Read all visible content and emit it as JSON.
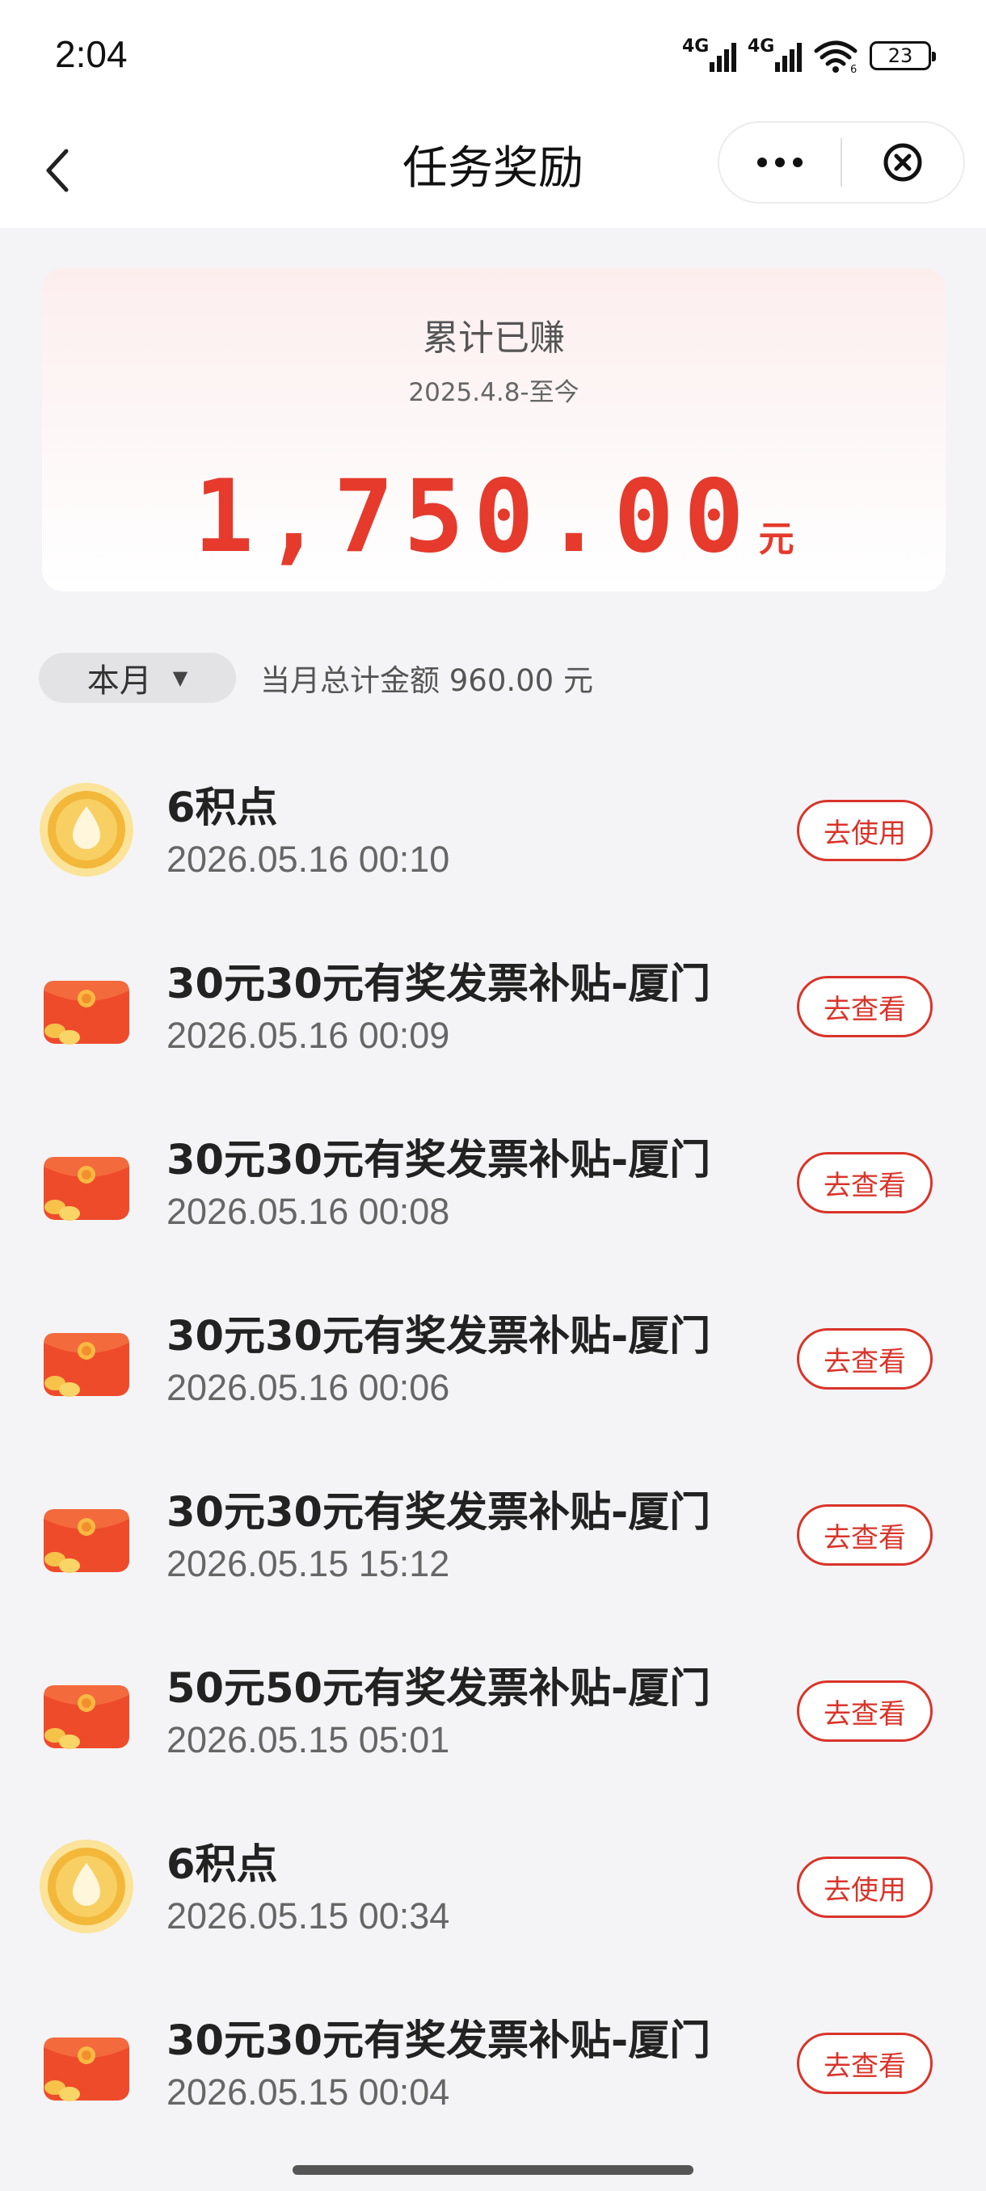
{
  "status_bar": {
    "time": "2:04",
    "signal1_label": "4G",
    "signal2_label": "4G",
    "wifi_label": "6",
    "battery": "23"
  },
  "header": {
    "title": "任务奖励",
    "back_icon": "chevron-left-icon",
    "more_icon": "more-dots-icon",
    "close_icon": "circle-close-icon"
  },
  "summary": {
    "title": "累计已赚",
    "range": "2025.4.8-至今",
    "amount": "1,750.00",
    "unit": "元",
    "accent_color": "#e53a2c"
  },
  "filter": {
    "month_label": "本月",
    "month_total": "当月总计金额 960.00 元"
  },
  "rewards": [
    {
      "icon": "points-drop-icon",
      "title": "6积点",
      "time": "2026.05.16 00:10",
      "action": "去使用"
    },
    {
      "icon": "red-packet-icon",
      "title": "30元30元有奖发票补贴-厦门",
      "time": "2026.05.16 00:09",
      "action": "去查看"
    },
    {
      "icon": "red-packet-icon",
      "title": "30元30元有奖发票补贴-厦门",
      "time": "2026.05.16 00:08",
      "action": "去查看"
    },
    {
      "icon": "red-packet-icon",
      "title": "30元30元有奖发票补贴-厦门",
      "time": "2026.05.16 00:06",
      "action": "去查看"
    },
    {
      "icon": "red-packet-icon",
      "title": "30元30元有奖发票补贴-厦门",
      "time": "2026.05.15 15:12",
      "action": "去查看"
    },
    {
      "icon": "red-packet-icon",
      "title": "50元50元有奖发票补贴-厦门",
      "time": "2026.05.15 05:01",
      "action": "去查看"
    },
    {
      "icon": "points-drop-icon",
      "title": "6积点",
      "time": "2026.05.15 00:34",
      "action": "去使用"
    },
    {
      "icon": "red-packet-icon",
      "title": "30元30元有奖发票补贴-厦门",
      "time": "2026.05.15 00:04",
      "action": "去查看"
    }
  ]
}
